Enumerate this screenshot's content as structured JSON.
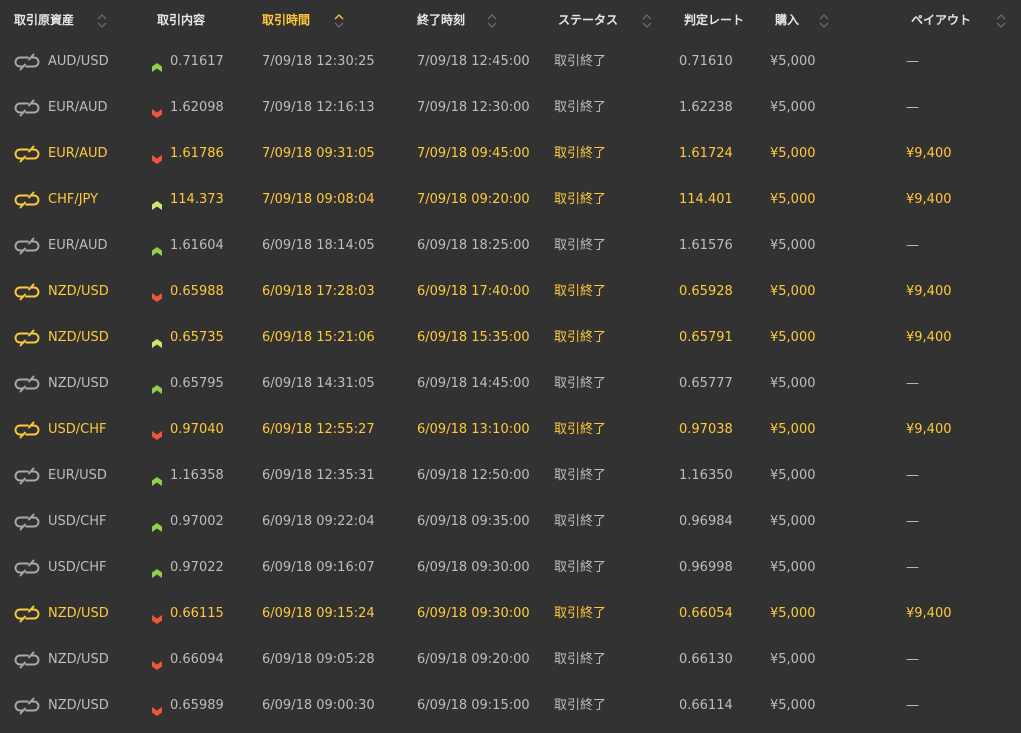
{
  "columns": [
    {
      "key": "asset",
      "label": "取引原資産"
    },
    {
      "key": "content",
      "label": "取引内容"
    },
    {
      "key": "trade_time",
      "label": "取引時間",
      "active": true
    },
    {
      "key": "end_time",
      "label": "終了時刻"
    },
    {
      "key": "status",
      "label": "ステータス"
    },
    {
      "key": "rate",
      "label": "判定レート"
    },
    {
      "key": "purchase",
      "label": "購入"
    },
    {
      "key": "payout",
      "label": "ペイアウト"
    }
  ],
  "colors": {
    "background": "#323232",
    "text": "#bdbdbd",
    "win": "#ffc93a",
    "up_arrow": "#8ed14a",
    "down_arrow": "#f0553b",
    "sort_icon": "#6a6a6a"
  },
  "icons": {
    "asset": "exchange-icon",
    "up": "arrow-up-icon",
    "down": "arrow-down-icon",
    "sort": "sort-icon"
  },
  "rows": [
    {
      "asset": "AUD/USD",
      "direction": "up",
      "entry": "0.71617",
      "trade_time": "7/09/18 12:30:25",
      "end_time": "7/09/18 12:45:00",
      "status": "取引終了",
      "rate": "0.71610",
      "purchase": "¥5,000",
      "payout": "—",
      "win": false
    },
    {
      "asset": "EUR/AUD",
      "direction": "down",
      "entry": "1.62098",
      "trade_time": "7/09/18 12:16:13",
      "end_time": "7/09/18 12:30:00",
      "status": "取引終了",
      "rate": "1.62238",
      "purchase": "¥5,000",
      "payout": "—",
      "win": false
    },
    {
      "asset": "EUR/AUD",
      "direction": "down",
      "entry": "1.61786",
      "trade_time": "7/09/18 09:31:05",
      "end_time": "7/09/18 09:45:00",
      "status": "取引終了",
      "rate": "1.61724",
      "purchase": "¥5,000",
      "payout": "¥9,400",
      "win": true
    },
    {
      "asset": "CHF/JPY",
      "direction": "up",
      "entry": "114.373",
      "trade_time": "7/09/18 09:08:04",
      "end_time": "7/09/18 09:20:00",
      "status": "取引終了",
      "rate": "114.401",
      "purchase": "¥5,000",
      "payout": "¥9,400",
      "win": true
    },
    {
      "asset": "EUR/AUD",
      "direction": "up",
      "entry": "1.61604",
      "trade_time": "6/09/18 18:14:05",
      "end_time": "6/09/18 18:25:00",
      "status": "取引終了",
      "rate": "1.61576",
      "purchase": "¥5,000",
      "payout": "—",
      "win": false
    },
    {
      "asset": "NZD/USD",
      "direction": "down",
      "entry": "0.65988",
      "trade_time": "6/09/18 17:28:03",
      "end_time": "6/09/18 17:40:00",
      "status": "取引終了",
      "rate": "0.65928",
      "purchase": "¥5,000",
      "payout": "¥9,400",
      "win": true
    },
    {
      "asset": "NZD/USD",
      "direction": "up",
      "entry": "0.65735",
      "trade_time": "6/09/18 15:21:06",
      "end_time": "6/09/18 15:35:00",
      "status": "取引終了",
      "rate": "0.65791",
      "purchase": "¥5,000",
      "payout": "¥9,400",
      "win": true
    },
    {
      "asset": "NZD/USD",
      "direction": "up",
      "entry": "0.65795",
      "trade_time": "6/09/18 14:31:05",
      "end_time": "6/09/18 14:45:00",
      "status": "取引終了",
      "rate": "0.65777",
      "purchase": "¥5,000",
      "payout": "—",
      "win": false
    },
    {
      "asset": "USD/CHF",
      "direction": "down",
      "entry": "0.97040",
      "trade_time": "6/09/18 12:55:27",
      "end_time": "6/09/18 13:10:00",
      "status": "取引終了",
      "rate": "0.97038",
      "purchase": "¥5,000",
      "payout": "¥9,400",
      "win": true
    },
    {
      "asset": "EUR/USD",
      "direction": "up",
      "entry": "1.16358",
      "trade_time": "6/09/18 12:35:31",
      "end_time": "6/09/18 12:50:00",
      "status": "取引終了",
      "rate": "1.16350",
      "purchase": "¥5,000",
      "payout": "—",
      "win": false
    },
    {
      "asset": "USD/CHF",
      "direction": "up",
      "entry": "0.97002",
      "trade_time": "6/09/18 09:22:04",
      "end_time": "6/09/18 09:35:00",
      "status": "取引終了",
      "rate": "0.96984",
      "purchase": "¥5,000",
      "payout": "—",
      "win": false
    },
    {
      "asset": "USD/CHF",
      "direction": "up",
      "entry": "0.97022",
      "trade_time": "6/09/18 09:16:07",
      "end_time": "6/09/18 09:30:00",
      "status": "取引終了",
      "rate": "0.96998",
      "purchase": "¥5,000",
      "payout": "—",
      "win": false
    },
    {
      "asset": "NZD/USD",
      "direction": "down",
      "entry": "0.66115",
      "trade_time": "6/09/18 09:15:24",
      "end_time": "6/09/18 09:30:00",
      "status": "取引終了",
      "rate": "0.66054",
      "purchase": "¥5,000",
      "payout": "¥9,400",
      "win": true
    },
    {
      "asset": "NZD/USD",
      "direction": "down",
      "entry": "0.66094",
      "trade_time": "6/09/18 09:05:28",
      "end_time": "6/09/18 09:20:00",
      "status": "取引終了",
      "rate": "0.66130",
      "purchase": "¥5,000",
      "payout": "—",
      "win": false
    },
    {
      "asset": "NZD/USD",
      "direction": "down",
      "entry": "0.65989",
      "trade_time": "6/09/18 09:00:30",
      "end_time": "6/09/18 09:15:00",
      "status": "取引終了",
      "rate": "0.66114",
      "purchase": "¥5,000",
      "payout": "—",
      "win": false
    }
  ]
}
